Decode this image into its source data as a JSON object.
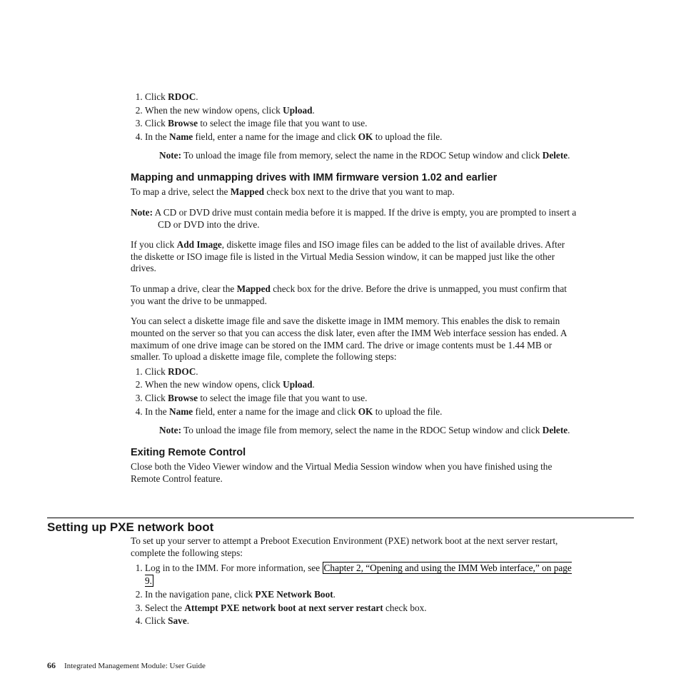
{
  "stepsA": {
    "i1_pre": "Click ",
    "i1_b": "RDOC",
    "i1_post": ".",
    "i2_pre": "When the new window opens, click ",
    "i2_b": "Upload",
    "i2_post": ".",
    "i3_pre": "Click ",
    "i3_b": "Browse",
    "i3_post": " to select the image file that you want to use.",
    "i4_pre": "In the ",
    "i4_b1": "Name",
    "i4_mid": " field, enter a name for the image and click ",
    "i4_b2": "OK",
    "i4_post": " to upload the file.",
    "note_label": "Note:",
    "note_pre": " To unload the image file from memory, select the name in the RDOC Setup window and click ",
    "note_b": "Delete",
    "note_post": "."
  },
  "mapHeading": "Mapping and unmapping drives with IMM firmware version 1.02 and earlier",
  "map_p1_pre": "To map a drive, select the ",
  "map_p1_b": "Mapped",
  "map_p1_post": " check box next to the drive that you want to map.",
  "map_note_label": "Note:",
  "map_note_text": " A CD or DVD drive must contain media before it is mapped. If the drive is empty, you are prompted to insert a CD or DVD into the drive.",
  "map_p2_pre": "If you click ",
  "map_p2_b": "Add Image",
  "map_p2_post": ", diskette image files and ISO image files can be added to the list of available drives. After the diskette or ISO image file is listed in the Virtual Media Session window, it can be mapped just like the other drives.",
  "map_p3_pre": "To unmap a drive, clear the ",
  "map_p3_b": "Mapped",
  "map_p3_post": " check box for the drive. Before the drive is unmapped, you must confirm that you want the drive to be unmapped.",
  "map_p4": "You can select a diskette image file and save the diskette image in IMM memory. This enables the disk to remain mounted on the server so that you can access the disk later, even after the IMM Web interface session has ended. A maximum of one drive image can be stored on the IMM card. The drive or image contents must be 1.44 MB or smaller. To upload a diskette image file, complete the following steps:",
  "exitHeading": "Exiting Remote Control",
  "exit_p": "Close both the Video Viewer window and the Virtual Media Session window when you have finished using the Remote Control feature.",
  "pxeHeading": "Setting up PXE network boot",
  "pxe_intro": "To set up your server to attempt a Preboot Execution Environment (PXE) network boot at the next server restart, complete the following steps:",
  "pxe": {
    "i1_pre": "Log in to the IMM. For more information, see ",
    "i1_link": "Chapter 2, “Opening and using the IMM Web interface,” on page 9.",
    "i2_pre": "In the navigation pane, click ",
    "i2_b": "PXE Network Boot",
    "i2_post": ".",
    "i3_pre": "Select the ",
    "i3_b": "Attempt PXE network boot at next server restart",
    "i3_post": " check box.",
    "i4_pre": "Click ",
    "i4_b": "Save",
    "i4_post": "."
  },
  "footer": {
    "pageNum": "66",
    "title": "Integrated Management Module:  User Guide"
  }
}
